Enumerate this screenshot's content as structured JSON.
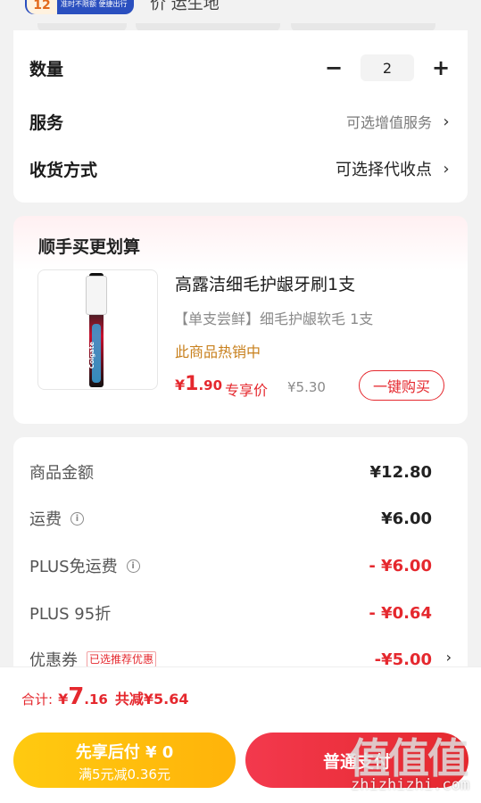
{
  "top": {
    "promo_number": "12",
    "promo_text": "准时不限额 便捷出行",
    "cut_text": "价 运生地"
  },
  "order": {
    "quantity_label": "数量",
    "quantity_minus": "−",
    "quantity_value": "2",
    "quantity_plus": "+",
    "service_label": "服务",
    "service_value": "可选增值服务",
    "delivery_label": "收货方式",
    "delivery_value": "可选择代收点",
    "chevron": "›"
  },
  "recommend": {
    "title": "顺手买更划算",
    "thumb_brand": "Colgate",
    "product_name": "高露洁细毛护龈牙刷1支",
    "spec": "【单支尝鲜】细毛护龈软毛 1支",
    "hot_label": "此商品热销中",
    "price_currency": "¥",
    "price_int": "1",
    "price_dec": ".90",
    "price_tag": "专享价",
    "original_price": "¥5.30",
    "buy_button": "一键购买"
  },
  "amounts": {
    "rows": [
      {
        "label": "商品金额",
        "value": "¥12.80"
      },
      {
        "label": "运费",
        "value": "¥6.00"
      },
      {
        "label": "PLUS免运费",
        "value": "- ¥6.00"
      },
      {
        "label": "PLUS 95折",
        "value": "- ¥0.64"
      },
      {
        "label": "优惠券",
        "tag": "已选推荐优惠",
        "value": "-¥5.00"
      }
    ],
    "info_glyph": "i",
    "chevron": "›"
  },
  "summary": {
    "label": "合计:",
    "currency": "¥",
    "int": "7",
    "dec": ".16",
    "savings": "共减¥5.64"
  },
  "actions": {
    "pay_later_line1": "先享后付 ¥ 0",
    "pay_later_line2": "满5元减0.36元",
    "pay_normal": "普通支付"
  },
  "watermark": {
    "logo": "值值值",
    "url": "zhizhizhi.com"
  },
  "colors": {
    "accent_red": "#e5282e",
    "hot_orange": "#c8801d",
    "pay_later_yellow": "#ffb30a"
  }
}
